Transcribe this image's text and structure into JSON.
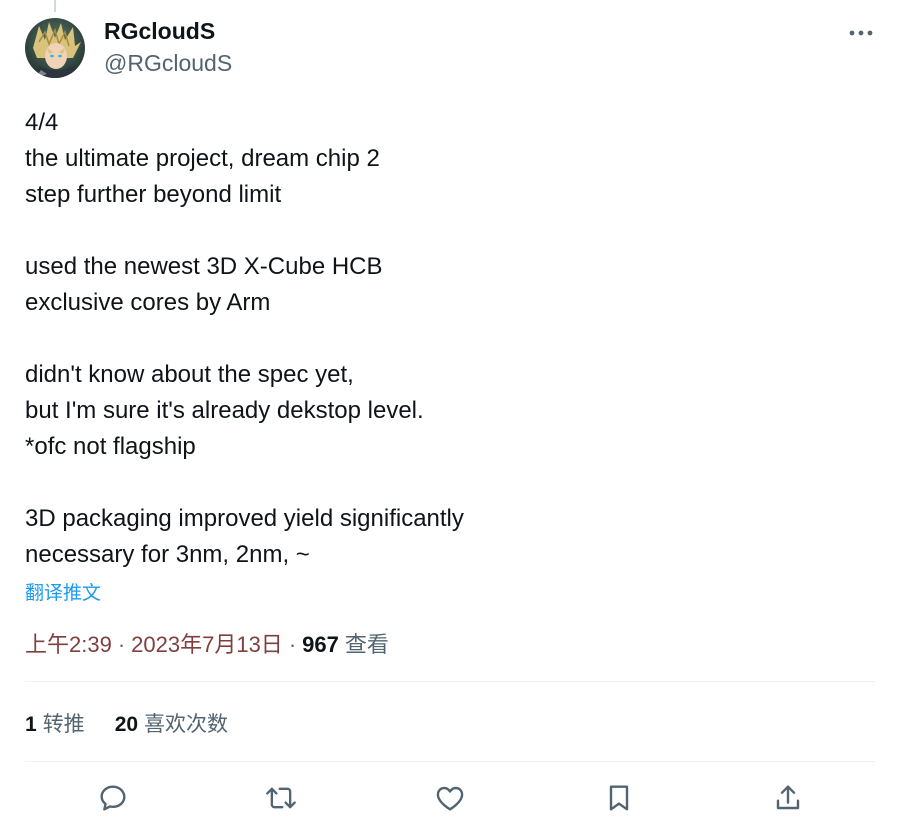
{
  "author": {
    "display_name": "RGcloudS",
    "handle": "@RGcloudS",
    "avatar_icon": "anime-character-avatar"
  },
  "tweet": {
    "lines": [
      "4/4",
      "the ultimate project, dream chip 2",
      "step further beyond limit",
      "",
      "used the newest 3D X-Cube HCB",
      "exclusive cores by Arm",
      "",
      "didn't know about the spec yet,",
      "but I'm sure it's already dekstop level.",
      "*ofc not flagship",
      "",
      "3D packaging improved yield significantly",
      "necessary for 3nm, 2nm, ~"
    ],
    "translate_label": "翻译推文"
  },
  "meta": {
    "time": "上午2:39",
    "separator": "·",
    "date": "2023年7月13日",
    "views_count": "967",
    "views_label": "查看"
  },
  "stats": {
    "retweets_count": "1",
    "retweets_label": "转推",
    "likes_count": "20",
    "likes_label": "喜欢次数"
  },
  "actions": {
    "icons": [
      "reply-icon",
      "retweet-icon",
      "like-icon",
      "bookmark-icon",
      "share-icon"
    ]
  },
  "colors": {
    "text": "#0f1419",
    "secondary": "#536471",
    "link": "#1d9bf0",
    "timestamp": "#7f3f3f",
    "divider": "#eff3f4"
  }
}
